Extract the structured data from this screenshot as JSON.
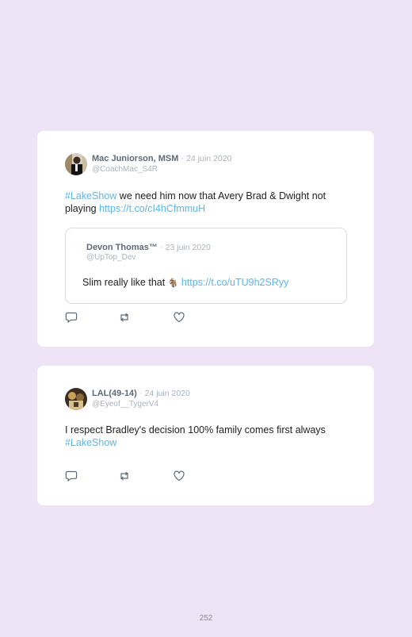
{
  "tweets": [
    {
      "author_name": "Mac Juniorson, MSM",
      "separator": "·",
      "date": "24 juin 2020",
      "handle": "@CoachMac_S4R",
      "hashtag": "#LakeShow",
      "text": " we need him now that Avery Brad & Dwight not playing ",
      "link": "https://t.co/cI4hCfmmuH",
      "quoted": {
        "author_name": "Devon Thomas™",
        "separator": "·",
        "date": "23 juin 2020",
        "handle": "@UpTop_Dev",
        "text": "Slim really like that ",
        "emoji": "🐐",
        "link": "https://t.co/uTU9h2SRyy"
      }
    },
    {
      "author_name": "LAL(49-14)",
      "separator": "·",
      "date": "24 juin 2020",
      "handle": "@Eyeof__TygerV4",
      "text": "I respect Bradley's decision 100% family comes first always",
      "hashtag": "#LakeShow"
    }
  ],
  "page_number": "252",
  "icons": [
    "reply-icon",
    "retweet-icon",
    "like-icon"
  ],
  "colors": {
    "background": "#efe3f6",
    "card": "#ffffff",
    "link": "#5fb5e6",
    "muted": "#aab3bb",
    "name": "#5d6a78"
  }
}
